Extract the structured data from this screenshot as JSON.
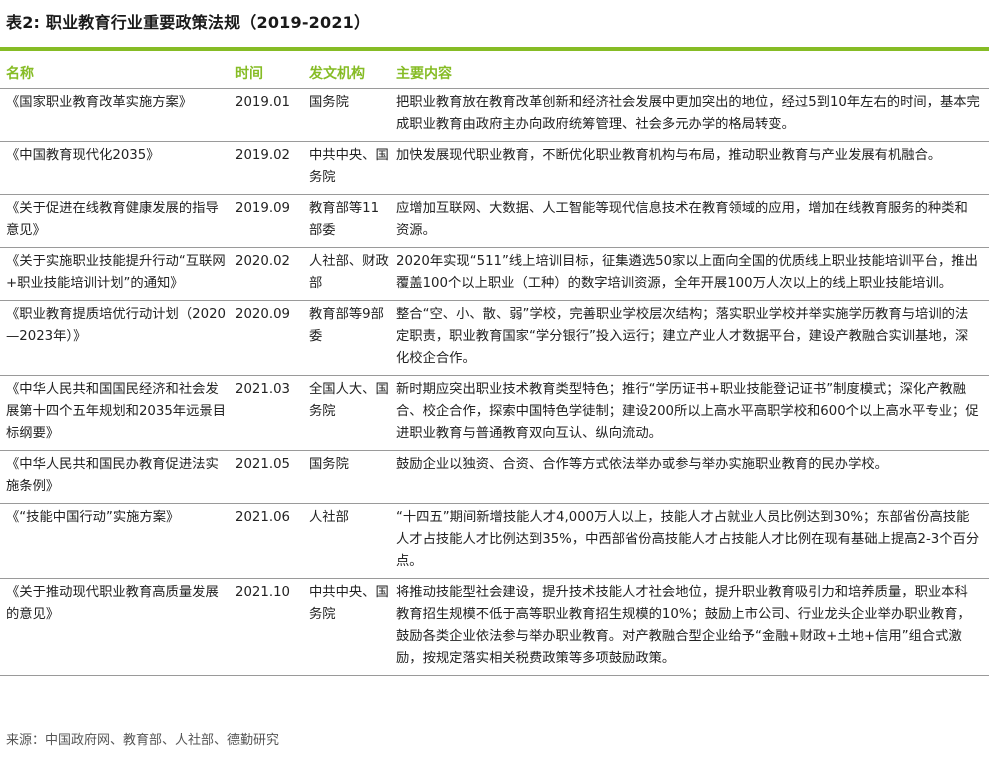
{
  "title": "表2: 职业教育行业重要政策法规（2019-2021）",
  "headers": {
    "name": "名称",
    "time": "时间",
    "agency": "发文机构",
    "content": "主要内容"
  },
  "rows": [
    {
      "name": "《国家职业教育改革实施方案》",
      "time": "2019.01",
      "agency": "国务院",
      "content": "把职业教育放在教育改革创新和经济社会发展中更加突出的地位，经过5到10年左右的时间，基本完成职业教育由政府主办向政府统筹管理、社会多元办学的格局转变。"
    },
    {
      "name": "《中国教育现代化2035》",
      "time": "2019.02",
      "agency": "中共中央、国务院",
      "content": "加快发展现代职业教育，不断优化职业教育机构与布局，推动职业教育与产业发展有机融合。"
    },
    {
      "name": "《关于促进在线教育健康发展的指导意见》",
      "time": "2019.09",
      "agency": "教育部等11 部委",
      "content": "应增加互联网、大数据、人工智能等现代信息技术在教育领域的应用，增加在线教育服务的种类和资源。"
    },
    {
      "name": "《关于实施职业技能提升行动“互联网+职业技能培训计划”的通知》",
      "time": "2020.02",
      "agency": "人社部、财政部",
      "content": "2020年实现“511”线上培训目标，征集遴选50家以上面向全国的优质线上职业技能培训平台，推出覆盖100个以上职业（工种）的数字培训资源，全年开展100万人次以上的线上职业技能培训。"
    },
    {
      "name": "《职业教育提质培优行动计划（2020—2023年）》",
      "time": "2020.09",
      "agency": "教育部等9部委",
      "content": "整合“空、小、散、弱”学校，完善职业学校层次结构；落实职业学校并举实施学历教育与培训的法定职责，职业教育国家“学分银行”投入运行；建立产业人才数据平台，建设产教融合实训基地，深化校企合作。"
    },
    {
      "name": "《中华人民共和国国民经济和社会发展第十四个五年规划和2035年远景目标纲要》",
      "time": "2021.03",
      "agency": "全国人大、国务院",
      "content": "新时期应突出职业技术教育类型特色；推行“学历证书+职业技能登记证书”制度模式；深化产教融合、校企合作，探索中国特色学徒制；建设200所以上高水平高职学校和600个以上高水平专业；促进职业教育与普通教育双向互认、纵向流动。"
    },
    {
      "name": "《中华人民共和国民办教育促进法实施条例》",
      "time": "2021.05",
      "agency": "国务院",
      "content": "鼓励企业以独资、合资、合作等方式依法举办或参与举办实施职业教育的民办学校。"
    },
    {
      "name": "《“技能中国行动”实施方案》",
      "time": "2021.06",
      "agency": "人社部",
      "content": "“十四五”期间新增技能人才4,000万人以上，技能人才占就业人员比例达到30%；东部省份高技能人才占技能人才比例达到35%，中西部省份高技能人才占技能人才比例在现有基础上提高2-3个百分点。"
    },
    {
      "name": "《关于推动现代职业教育高质量发展的意见》",
      "time": "2021.10",
      "agency": "中共中央、国务院",
      "content": "将推动技能型社会建设，提升技术技能人才社会地位，提升职业教育吸引力和培养质量，职业本科教育招生规模不低于高等职业教育招生规模的10%；鼓励上市公司、行业龙头企业举办职业教育，鼓励各类企业依法参与举办职业教育。对产教融合型企业给予“金融+财政+土地+信用”组合式激励，按规定落实相关税费政策等多项鼓励政策。"
    }
  ],
  "source": "来源：中国政府网、教育部、人社部、德勤研究",
  "colors": {
    "accent": "#86bc25",
    "rule": "#9a9a9a",
    "text": "#222222"
  }
}
